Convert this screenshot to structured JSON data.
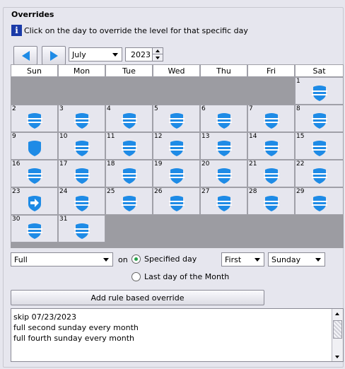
{
  "section": {
    "title": "Overrides"
  },
  "info": {
    "icon": "info-icon",
    "text": "Click on the day to override the level for that specific day"
  },
  "nav": {
    "month": "July",
    "year": "2023"
  },
  "calendar": {
    "weekdays": [
      "Sun",
      "Mon",
      "Tue",
      "Wed",
      "Thu",
      "Fri",
      "Sat"
    ],
    "days": [
      {
        "day": "1",
        "icon": "shield-striped"
      },
      {
        "day": "2",
        "icon": "shield-striped"
      },
      {
        "day": "3",
        "icon": "shield-striped"
      },
      {
        "day": "4",
        "icon": "shield-striped"
      },
      {
        "day": "5",
        "icon": "shield-striped"
      },
      {
        "day": "6",
        "icon": "shield-striped"
      },
      {
        "day": "7",
        "icon": "shield-striped"
      },
      {
        "day": "8",
        "icon": "shield-striped"
      },
      {
        "day": "9",
        "icon": "shield-full"
      },
      {
        "day": "10",
        "icon": "shield-striped"
      },
      {
        "day": "11",
        "icon": "shield-striped"
      },
      {
        "day": "12",
        "icon": "shield-striped"
      },
      {
        "day": "13",
        "icon": "shield-striped"
      },
      {
        "day": "14",
        "icon": "shield-striped"
      },
      {
        "day": "15",
        "icon": "shield-striped"
      },
      {
        "day": "16",
        "icon": "shield-striped"
      },
      {
        "day": "17",
        "icon": "shield-striped"
      },
      {
        "day": "18",
        "icon": "shield-striped"
      },
      {
        "day": "19",
        "icon": "shield-striped"
      },
      {
        "day": "20",
        "icon": "shield-striped"
      },
      {
        "day": "21",
        "icon": "shield-striped"
      },
      {
        "day": "22",
        "icon": "shield-striped"
      },
      {
        "day": "23",
        "icon": "shield-skip"
      },
      {
        "day": "24",
        "icon": "shield-striped"
      },
      {
        "day": "25",
        "icon": "shield-striped"
      },
      {
        "day": "26",
        "icon": "shield-striped"
      },
      {
        "day": "27",
        "icon": "shield-striped"
      },
      {
        "day": "28",
        "icon": "shield-striped"
      },
      {
        "day": "29",
        "icon": "shield-striped"
      },
      {
        "day": "30",
        "icon": "shield-striped"
      },
      {
        "day": "31",
        "icon": "shield-striped"
      }
    ]
  },
  "rule": {
    "level": "Full",
    "on_label": "on",
    "specified_day_label": "Specified day",
    "last_day_label": "Last day of the Month",
    "ordinal": "First",
    "weekday": "Sunday",
    "add_button": "Add rule based override"
  },
  "rules_list": [
    "skip 07/23/2023",
    "full second sunday every month",
    "full fourth sunday every month"
  ],
  "colors": {
    "accent": "#1e8be6",
    "background": "#e6e6ee",
    "empty_cell": "#9c9ca2"
  }
}
